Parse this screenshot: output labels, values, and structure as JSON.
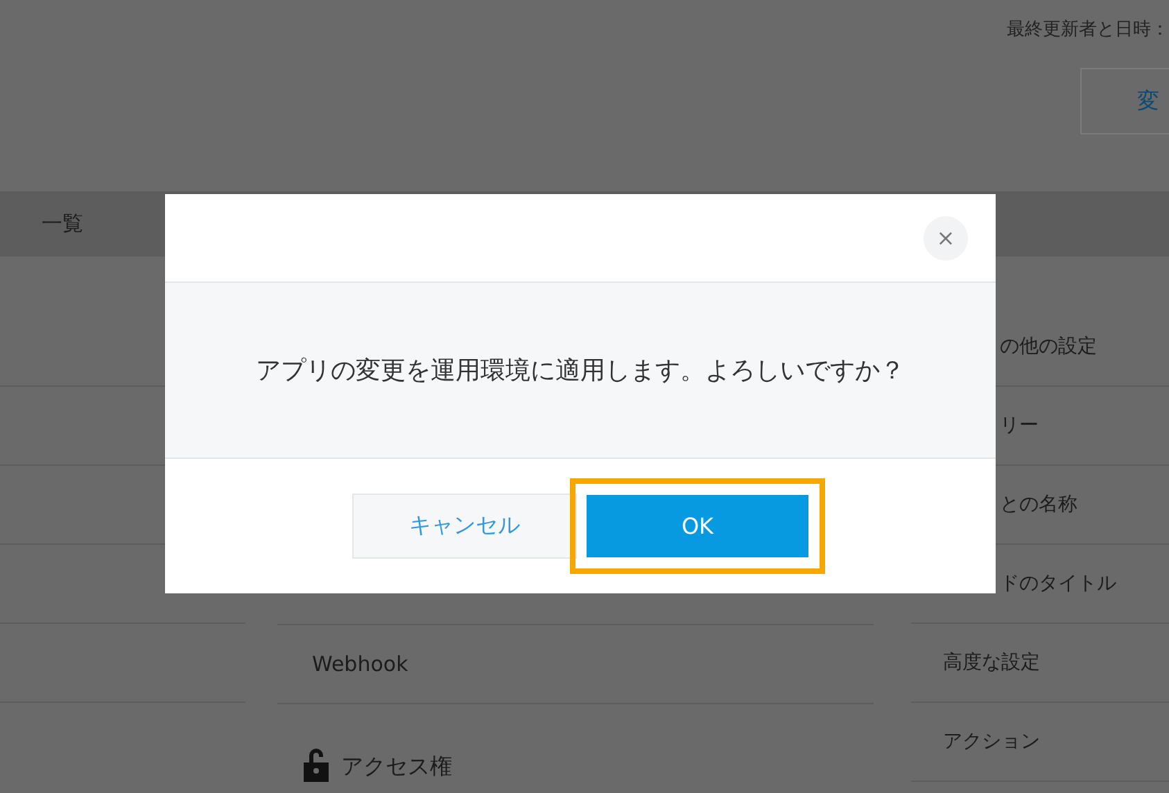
{
  "header": {
    "last_updated_label": "最終更新者と日時：",
    "change_button": "変"
  },
  "tab_label": "一覧",
  "settings_middle": [
    {
      "kind": "item",
      "label": "Webhook"
    },
    {
      "kind": "section",
      "label": "アクセス権"
    }
  ],
  "settings_right": [
    {
      "kind": "cut",
      "label": "の他の設定"
    },
    {
      "kind": "cut",
      "label": "リー"
    },
    {
      "kind": "cut",
      "label": "との名称"
    },
    {
      "kind": "cut",
      "label": "ドのタイトル"
    },
    {
      "kind": "item",
      "label": "高度な設定"
    },
    {
      "kind": "item",
      "label": "アクション"
    }
  ],
  "dialog": {
    "close_label": "×",
    "message": "アプリの変更を運用環境に適用します。よろしいですか？",
    "buttons": [
      {
        "kind": "secondary",
        "label": "キャンセル",
        "focused": false
      },
      {
        "kind": "primary",
        "label": "OK",
        "focused": true
      }
    ]
  }
}
